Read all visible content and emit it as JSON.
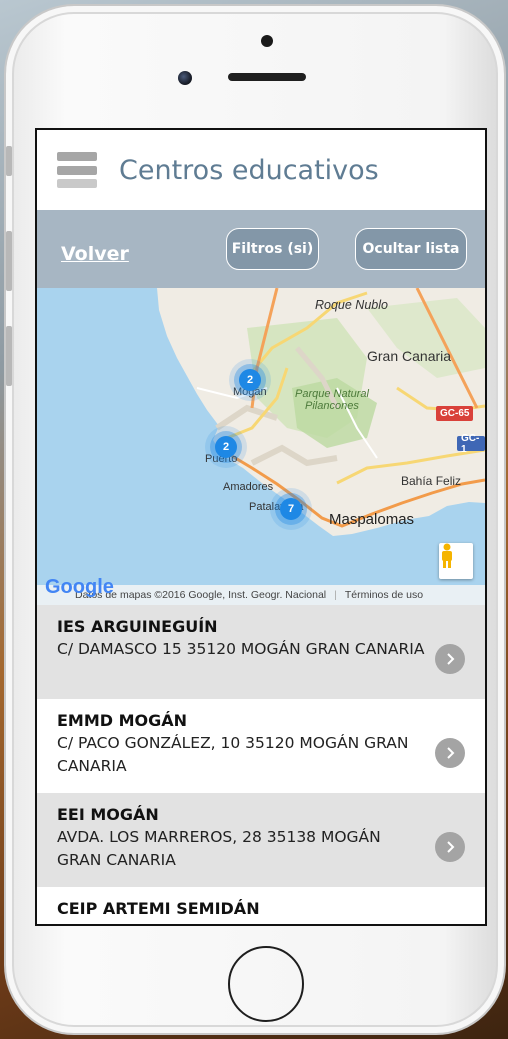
{
  "app": {
    "title": "Centros educativos"
  },
  "toolbar": {
    "back_label": "Volver",
    "filters_label": "Filtros (si)",
    "hide_list_label": "Ocultar lista"
  },
  "map": {
    "places": {
      "roque_nublo": "Roque Nublo",
      "gran_canaria": "Gran Canaria",
      "mogan": "Mogán",
      "parque_natural": "Parque Natural",
      "pilancones": "Pilancones",
      "puerto": "Puerto",
      "amadores": "Amadores",
      "patalavaca": "Patalavaca",
      "bahia_feliz": "Bahía Feliz",
      "maspalomas": "Maspalomas"
    },
    "roads": {
      "gc65": "GC-65",
      "gc1": "GC-1"
    },
    "clusters": [
      {
        "count": "2"
      },
      {
        "count": "2"
      },
      {
        "count": "7"
      }
    ],
    "google_logo": "Google",
    "attribution": "Datos de mapas ©2016 Google, Inst. Geogr. Nacional",
    "terms": "Términos de uso"
  },
  "centers": [
    {
      "name": "IES ARGUINEGUÍN",
      "address": "C/ DAMASCO 15 35120 MOGÁN GRAN CANARIA"
    },
    {
      "name": "EMMD MOGÁN",
      "address": "C/ PACO GONZÁLEZ, 10 35120 MOGÁN GRAN CANARIA"
    },
    {
      "name": "EEI MOGÁN",
      "address": "AVDA. LOS MARREROS, 28 35138 MOGÁN GRAN CANARIA"
    },
    {
      "name": "CEIP ARTEMI SEMIDÁN",
      "address": ""
    }
  ],
  "colors": {
    "title": "#5f7c93",
    "toolbar": "#a7b6c3",
    "button": "#8397a8",
    "cluster": "#1e88e5",
    "row_shade": "#e2e2e2"
  }
}
